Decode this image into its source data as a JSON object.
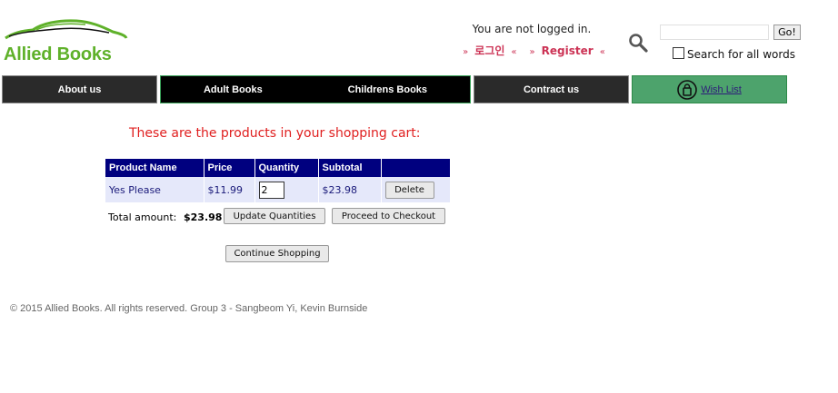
{
  "brand": {
    "name": "Allied Books",
    "logo_color": "#5fb12a"
  },
  "header": {
    "login_status": "You are not logged in.",
    "login_link": "로그인",
    "register_link": "Register",
    "guillemet_open": "»",
    "guillemet_close": "«",
    "search_icon": "search-icon",
    "search_value": "",
    "go_label": "Go!",
    "search_all_label": "Search for all words",
    "search_all_checked": false
  },
  "nav": {
    "about": "About us",
    "adult": "Adult Books",
    "children": "Childrens Books",
    "contract": "Contract us",
    "wish": "Wish List"
  },
  "cart": {
    "heading": "These are the products in your shopping cart:",
    "columns": [
      "Product Name",
      "Price",
      "Quantity",
      "Subtotal",
      ""
    ],
    "rows": [
      {
        "name": "Yes Please",
        "price": "$11.99",
        "quantity": "2",
        "subtotal": "$23.98",
        "action": "Delete"
      }
    ],
    "total_label": "Total amount:",
    "total_value": "$23.98",
    "update_label": "Update Quantities",
    "checkout_label": "Proceed to Checkout",
    "continue_label": "Continue Shopping"
  },
  "colors": {
    "table_header_bg": "#00007f",
    "table_row_bg": "#e5e8fa",
    "heading_red": "#e02020",
    "auth_pink": "#cc3355",
    "wish_green": "#4da36c"
  },
  "footer": {
    "text": "© 2015 Allied Books. All rights reserved. Group 3 - Sangbeom Yi, Kevin Burnside"
  }
}
